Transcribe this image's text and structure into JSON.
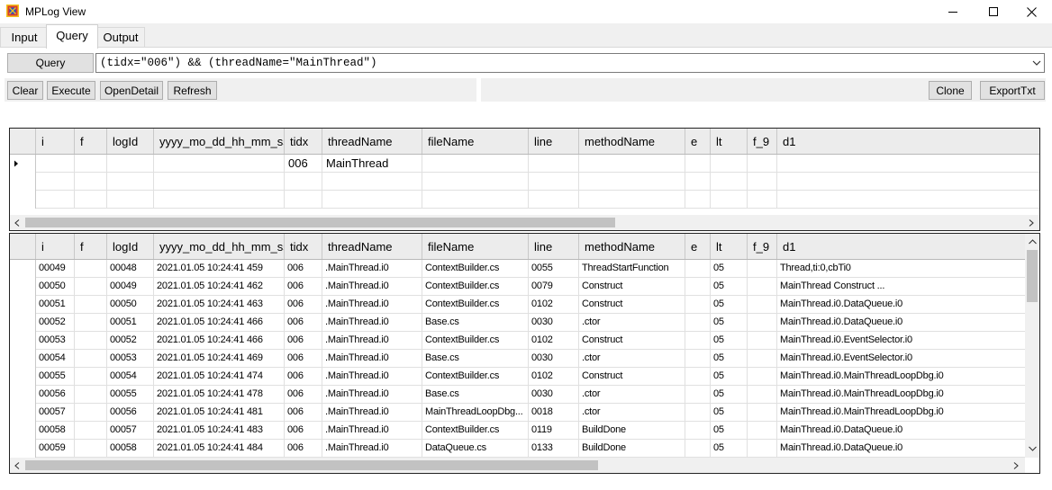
{
  "window": {
    "title": "MPLog View"
  },
  "tabs": [
    {
      "label": "Input"
    },
    {
      "label": "Query"
    },
    {
      "label": "Output"
    }
  ],
  "toolbar": {
    "query_button": "Query",
    "query_text": "(tidx=\"006\") && (threadName=\"MainThread\")",
    "clear": "Clear",
    "execute": "Execute",
    "open_detail": "OpenDetail",
    "refresh": "Refresh",
    "clone": "Clone",
    "export_txt": "ExportTxt"
  },
  "columns": [
    "i",
    "f",
    "logId",
    "yyyy_mo_dd_hh_mm_ss",
    "tidx",
    "threadName",
    "fileName",
    "line",
    "methodName",
    "e",
    "lt",
    "f_9",
    "d1"
  ],
  "criteria_grid": {
    "rows": [
      [
        "",
        "",
        "",
        "",
        "006",
        "MainThread",
        "",
        "",
        "",
        "",
        "",
        "",
        ""
      ],
      [
        "",
        "",
        "",
        "",
        "",
        "",
        "",
        "",
        "",
        "",
        "",
        "",
        ""
      ],
      [
        "",
        "",
        "",
        "",
        "",
        "",
        "",
        "",
        "",
        "",
        "",
        "",
        ""
      ]
    ]
  },
  "result_grid": {
    "rows": [
      [
        "00049",
        "",
        "00048",
        "2021.01.05 10:24:41 459",
        "006",
        ".MainThread.i0",
        "ContextBuilder.cs",
        "0055",
        "ThreadStartFunction",
        "",
        "05",
        "",
        "Thread,ti:0,cbTi0"
      ],
      [
        "00050",
        "",
        "00049",
        "2021.01.05 10:24:41 462",
        "006",
        ".MainThread.i0",
        "ContextBuilder.cs",
        "0079",
        "Construct",
        "",
        "05",
        "",
        "MainThread Construct ..."
      ],
      [
        "00051",
        "",
        "00050",
        "2021.01.05 10:24:41 463",
        "006",
        ".MainThread.i0",
        "ContextBuilder.cs",
        "0102",
        "Construct",
        "",
        "05",
        "",
        "MainThread.i0.DataQueue.i0"
      ],
      [
        "00052",
        "",
        "00051",
        "2021.01.05 10:24:41 466",
        "006",
        ".MainThread.i0",
        "Base.cs",
        "0030",
        ".ctor",
        "",
        "05",
        "",
        "MainThread.i0.DataQueue.i0"
      ],
      [
        "00053",
        "",
        "00052",
        "2021.01.05 10:24:41 466",
        "006",
        ".MainThread.i0",
        "ContextBuilder.cs",
        "0102",
        "Construct",
        "",
        "05",
        "",
        "MainThread.i0.EventSelector.i0"
      ],
      [
        "00054",
        "",
        "00053",
        "2021.01.05 10:24:41 469",
        "006",
        ".MainThread.i0",
        "Base.cs",
        "0030",
        ".ctor",
        "",
        "05",
        "",
        "MainThread.i0.EventSelector.i0"
      ],
      [
        "00055",
        "",
        "00054",
        "2021.01.05 10:24:41 474",
        "006",
        ".MainThread.i0",
        "ContextBuilder.cs",
        "0102",
        "Construct",
        "",
        "05",
        "",
        "MainThread.i0.MainThreadLoopDbg.i0"
      ],
      [
        "00056",
        "",
        "00055",
        "2021.01.05 10:24:41 478",
        "006",
        ".MainThread.i0",
        "Base.cs",
        "0030",
        ".ctor",
        "",
        "05",
        "",
        "MainThread.i0.MainThreadLoopDbg.i0"
      ],
      [
        "00057",
        "",
        "00056",
        "2021.01.05 10:24:41 481",
        "006",
        ".MainThread.i0",
        "MainThreadLoopDbg...",
        "0018",
        ".ctor",
        "",
        "05",
        "",
        "MainThread.i0.MainThreadLoopDbg.i0"
      ],
      [
        "00058",
        "",
        "00057",
        "2021.01.05 10:24:41 483",
        "006",
        ".MainThread.i0",
        "ContextBuilder.cs",
        "0119",
        "BuildDone",
        "",
        "05",
        "",
        "MainThread.i0.DataQueue.i0"
      ],
      [
        "00059",
        "",
        "00058",
        "2021.01.05 10:24:41 484",
        "006",
        ".MainThread.i0",
        "DataQueue.cs",
        "0133",
        "BuildDone",
        "",
        "05",
        "",
        "MainThread.i0.DataQueue.i0"
      ]
    ]
  },
  "colors": {
    "accent": "#0078d7",
    "app_icon_red": "#d93a2b",
    "app_icon_blue": "#1f4fd1",
    "app_icon_yellow": "#f2c21b"
  },
  "icons": [
    "app-icon",
    "minimize-icon",
    "maximize-icon",
    "close-icon",
    "chevron-down-icon",
    "row-pointer-icon",
    "scroll-left-icon",
    "scroll-right-icon",
    "scroll-up-icon",
    "scroll-down-icon"
  ]
}
